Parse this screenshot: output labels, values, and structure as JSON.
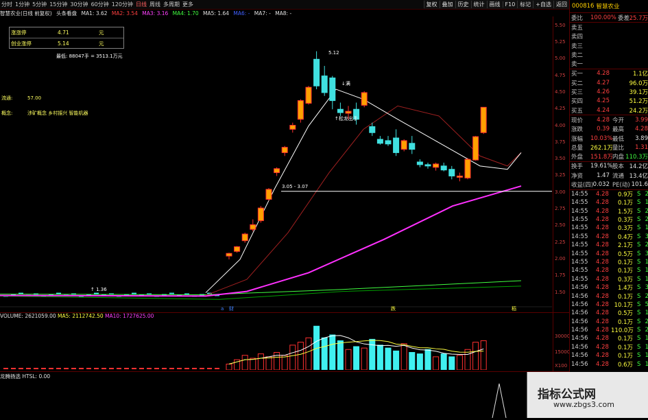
{
  "timeframes": [
    "分时",
    "1分钟",
    "5分钟",
    "15分钟",
    "30分钟",
    "60分钟",
    "120分钟",
    "日线",
    "周线",
    "多周期",
    "更多"
  ],
  "active_timeframe": "日线",
  "toolbar_buttons": [
    "复权",
    "叠加",
    "历史",
    "统计",
    "画线",
    "F10",
    "标记",
    "+自选",
    "返回"
  ],
  "info_line": {
    "title": "智慧农业(日线 前复权)",
    "indicator": "头条看盘",
    "ma1": "MA1: 3.62",
    "ma2": "MA2: 3.54",
    "ma3": "MA3: 3.16",
    "ma4": "MA4: 1.70",
    "ma5": "MA5: 1.64",
    "ma6": "MA6: -",
    "ma7": "MA7: -",
    "ma8": "MA8: -"
  },
  "info_box": [
    {
      "k": "涨涨停",
      "v": "4.71",
      "u": "元"
    },
    {
      "k": "创业涨停",
      "v": "5.14",
      "u": "元"
    }
  ],
  "chart_labels": {
    "high_note": "5.12",
    "kaiman": "↓满",
    "volume_note": "最低: 88047手 = 3513.1万元",
    "liutong_label": "流通:",
    "liutong_value": "57.00",
    "gainian_label": "概念:",
    "gainian_value": "涉矿概念 乡村振兴 智能机器",
    "chuxian": "↑松龙出手",
    "range_note": "3.05 - 3.07",
    "low_note": "↑ 1.36",
    "flag_a": "a",
    "flag_cai": "财",
    "flag_die": "跌",
    "flag_dao": "稻"
  },
  "chart_data": {
    "type": "candlestick",
    "ylim": [
      1.3,
      5.6
    ],
    "y_ticks": [
      "5.50",
      "5.25",
      "5.00",
      "4.75",
      "4.50",
      "4.25",
      "4.00",
      "3.75",
      "3.50",
      "3.25",
      "3.00",
      "2.75",
      "2.50",
      "2.25",
      "2.00",
      "1.75",
      "1.50"
    ],
    "candles_recent": [
      {
        "o": 2.05,
        "h": 2.1,
        "l": 2.0,
        "c": 2.09
      },
      {
        "o": 2.12,
        "h": 2.2,
        "l": 2.1,
        "c": 2.19
      },
      {
        "o": 2.28,
        "h": 2.4,
        "l": 2.25,
        "c": 2.38
      },
      {
        "o": 2.45,
        "h": 2.6,
        "l": 2.42,
        "c": 2.52
      },
      {
        "o": 2.58,
        "h": 2.8,
        "l": 2.55,
        "c": 2.77
      },
      {
        "o": 2.9,
        "h": 3.07,
        "l": 2.88,
        "c": 3.05
      },
      {
        "o": 3.3,
        "h": 3.38,
        "l": 3.25,
        "c": 3.36
      },
      {
        "o": 3.6,
        "h": 3.7,
        "l": 3.55,
        "c": 3.68
      },
      {
        "o": 3.95,
        "h": 4.05,
        "l": 3.9,
        "c": 4.01
      },
      {
        "o": 4.1,
        "h": 4.4,
        "l": 4.05,
        "c": 4.38
      },
      {
        "o": 4.34,
        "h": 4.6,
        "l": 4.32,
        "c": 4.58
      },
      {
        "o": 5.0,
        "h": 5.12,
        "l": 4.55,
        "c": 4.6
      },
      {
        "o": 4.75,
        "h": 4.9,
        "l": 4.45,
        "c": 4.5
      },
      {
        "o": 4.72,
        "h": 4.75,
        "l": 4.25,
        "c": 4.38
      },
      {
        "o": 4.25,
        "h": 4.35,
        "l": 4.15,
        "c": 4.2
      },
      {
        "o": 4.19,
        "h": 4.3,
        "l": 4.1,
        "c": 4.22
      },
      {
        "o": 4.25,
        "h": 4.35,
        "l": 4.02,
        "c": 4.1
      },
      {
        "o": 4.31,
        "h": 4.52,
        "l": 4.28,
        "c": 4.5
      },
      {
        "o": 3.99,
        "h": 4.05,
        "l": 3.85,
        "c": 3.9
      },
      {
        "o": 3.8,
        "h": 3.85,
        "l": 3.72,
        "c": 3.74
      },
      {
        "o": 3.78,
        "h": 3.85,
        "l": 3.7,
        "c": 3.73
      },
      {
        "o": 3.82,
        "h": 3.95,
        "l": 3.55,
        "c": 3.6
      },
      {
        "o": 3.65,
        "h": 3.8,
        "l": 3.62,
        "c": 3.78
      },
      {
        "o": 3.74,
        "h": 3.85,
        "l": 3.58,
        "c": 3.65
      },
      {
        "o": 3.46,
        "h": 3.5,
        "l": 3.38,
        "c": 3.42
      },
      {
        "o": 3.42,
        "h": 3.45,
        "l": 3.36,
        "c": 3.4
      },
      {
        "o": 3.38,
        "h": 3.45,
        "l": 3.33,
        "c": 3.43
      },
      {
        "o": 3.4,
        "h": 3.45,
        "l": 3.32,
        "c": 3.34
      },
      {
        "o": 3.35,
        "h": 3.4,
        "l": 3.2,
        "c": 3.25
      },
      {
        "o": 3.23,
        "h": 3.3,
        "l": 3.17,
        "c": 3.25
      },
      {
        "o": 3.22,
        "h": 3.52,
        "l": 3.2,
        "c": 3.5
      },
      {
        "o": 3.49,
        "h": 3.85,
        "l": 3.48,
        "c": 3.84
      },
      {
        "o": 3.9,
        "h": 4.28,
        "l": 3.88,
        "c": 4.28
      }
    ],
    "volume_info": {
      "volume": "VOLUME: 2621059.00",
      "ma5": "MA5: 2112742.50",
      "ma10": "MA10: 1727625.00"
    },
    "volume_ticks": [
      "30000",
      "15000",
      "X100"
    ],
    "volumes": [
      4,
      7,
      10,
      8,
      11,
      9,
      12,
      10,
      17,
      19,
      22,
      30,
      22,
      24,
      20,
      14,
      16,
      15,
      21,
      17,
      15,
      13,
      18,
      12,
      11,
      14,
      9,
      11,
      9,
      10,
      14,
      19,
      20
    ]
  },
  "indicator_info": "龙腾扬选 HTSL: 0.00",
  "panel": {
    "code": "000816",
    "name": "智慧农业",
    "weibi_label": "委比",
    "weibi_value": "100.00%",
    "weicha_label": "委差",
    "weicha_value": "25.7万",
    "sell": [
      {
        "label": "卖五",
        "price": "",
        "vol": ""
      },
      {
        "label": "卖四",
        "price": "",
        "vol": ""
      },
      {
        "label": "卖三",
        "price": "",
        "vol": ""
      },
      {
        "label": "卖二",
        "price": "",
        "vol": ""
      },
      {
        "label": "卖一",
        "price": "",
        "vol": ""
      }
    ],
    "buy": [
      {
        "label": "买一",
        "price": "4.28",
        "vol": "1.1亿"
      },
      {
        "label": "买二",
        "price": "4.27",
        "vol": "96.0万"
      },
      {
        "label": "买三",
        "price": "4.26",
        "vol": "39.1万"
      },
      {
        "label": "买四",
        "price": "4.25",
        "vol": "51.2万"
      },
      {
        "label": "买五",
        "price": "4.24",
        "vol": "24.2万"
      }
    ],
    "stats": [
      {
        "l1": "现价",
        "v1": "4.28",
        "c1": "red",
        "l2": "今开",
        "v2": "3.99",
        "c2": "red"
      },
      {
        "l1": "涨跌",
        "v1": "0.39",
        "c1": "red",
        "l2": "最高",
        "v2": "4.28",
        "c2": "red"
      },
      {
        "l1": "涨幅",
        "v1": "10.03%",
        "c1": "red",
        "l2": "最低",
        "v2": "3.89",
        "c2": "wht"
      },
      {
        "l1": "总量",
        "v1": "262.1万",
        "c1": "yel",
        "l2": "量比",
        "v2": "1.31",
        "c2": "red"
      },
      {
        "l1": "外盘",
        "v1": "151.8万",
        "c1": "red",
        "l2": "内盘",
        "v2": "110.3万",
        "c2": "grn"
      }
    ],
    "stats2": [
      {
        "l1": "换手",
        "v1": "19.61%",
        "c1": "wht",
        "l2": "股本",
        "v2": "14.2亿",
        "c2": "wht"
      },
      {
        "l1": "净资",
        "v1": "1.47",
        "c1": "wht",
        "l2": "流通",
        "v2": "13.4亿",
        "c2": "wht"
      },
      {
        "l1": "收益(四)",
        "v1": "0.032",
        "c1": "wht",
        "l2": "PE(动)",
        "v2": "101.6",
        "c2": "wht"
      }
    ],
    "ticks": [
      {
        "t": "14:55",
        "p": "4.28",
        "v": "0.9万",
        "s": "S",
        "n": "2"
      },
      {
        "t": "14:55",
        "p": "4.28",
        "v": "0.1万",
        "s": "S",
        "n": "1"
      },
      {
        "t": "14:55",
        "p": "4.28",
        "v": "1.5万",
        "s": "S",
        "n": "2"
      },
      {
        "t": "14:55",
        "p": "4.28",
        "v": "0.3万",
        "s": "S",
        "n": "2"
      },
      {
        "t": "14:55",
        "p": "4.28",
        "v": "0.3万",
        "s": "S",
        "n": "1"
      },
      {
        "t": "14:55",
        "p": "4.28",
        "v": "0.4万",
        "s": "S",
        "n": "3"
      },
      {
        "t": "14:55",
        "p": "4.28",
        "v": "2.1万",
        "s": "S",
        "n": "2"
      },
      {
        "t": "14:55",
        "p": "4.28",
        "v": "0.5万",
        "s": "S",
        "n": "3"
      },
      {
        "t": "14:55",
        "p": "4.28",
        "v": "0.1万",
        "s": "S",
        "n": "1"
      },
      {
        "t": "14:55",
        "p": "4.28",
        "v": "0.1万",
        "s": "S",
        "n": "1"
      },
      {
        "t": "14:55",
        "p": "4.28",
        "v": "0.3万",
        "s": "S",
        "n": "1"
      },
      {
        "t": "14:56",
        "p": "4.28",
        "v": "1.4万",
        "s": "S",
        "n": "3"
      },
      {
        "t": "14:56",
        "p": "4.28",
        "v": "0.1万",
        "s": "S",
        "n": "2"
      },
      {
        "t": "14:56",
        "p": "4.28",
        "v": "10.1万",
        "s": "S",
        "n": "5"
      },
      {
        "t": "14:56",
        "p": "4.28",
        "v": "0.5万",
        "s": "S",
        "n": "1"
      },
      {
        "t": "14:56",
        "p": "4.28",
        "v": "0.1万",
        "s": "S",
        "n": "2"
      },
      {
        "t": "14:56",
        "p": "4.28",
        "v": "110.0万",
        "s": "S",
        "n": "2"
      },
      {
        "t": "14:56",
        "p": "4.28",
        "v": "0.1万",
        "s": "S",
        "n": "1"
      },
      {
        "t": "14:56",
        "p": "4.28",
        "v": "0.1万",
        "s": "S",
        "n": "1"
      },
      {
        "t": "14:56",
        "p": "4.28",
        "v": "0.1万",
        "s": "S",
        "n": "1"
      },
      {
        "t": "14:56",
        "p": "4.28",
        "v": "0.6万",
        "s": "S",
        "n": "1"
      }
    ]
  },
  "watermark": {
    "title": "指标公式网",
    "url": "www.zbgs3.com"
  }
}
